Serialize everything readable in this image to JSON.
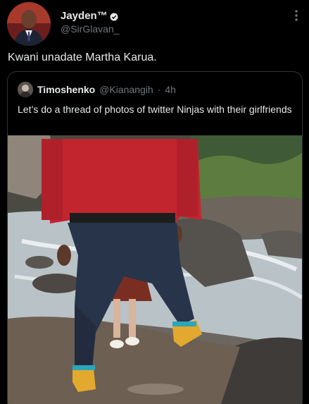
{
  "author": {
    "display_name": "Jayden™",
    "handle": "@SirGlavan_",
    "avatar_icon": "profile-photo"
  },
  "tweet": {
    "text": "Kwani unadate Martha Karua."
  },
  "quoted": {
    "display_name": "Timoshenko",
    "handle": "@Kianangih",
    "separator": "·",
    "time": "4h",
    "text": "Let’s do a thread of photos of twitter Ninjas  with their girlfriends"
  },
  "icons": {
    "verified": "verified-badge-icon",
    "more": "more-vertical-icon"
  },
  "colors": {
    "background": "#000000",
    "text_primary": "#e7e9ea",
    "text_secondary": "#71767b",
    "border": "#2f3336"
  }
}
